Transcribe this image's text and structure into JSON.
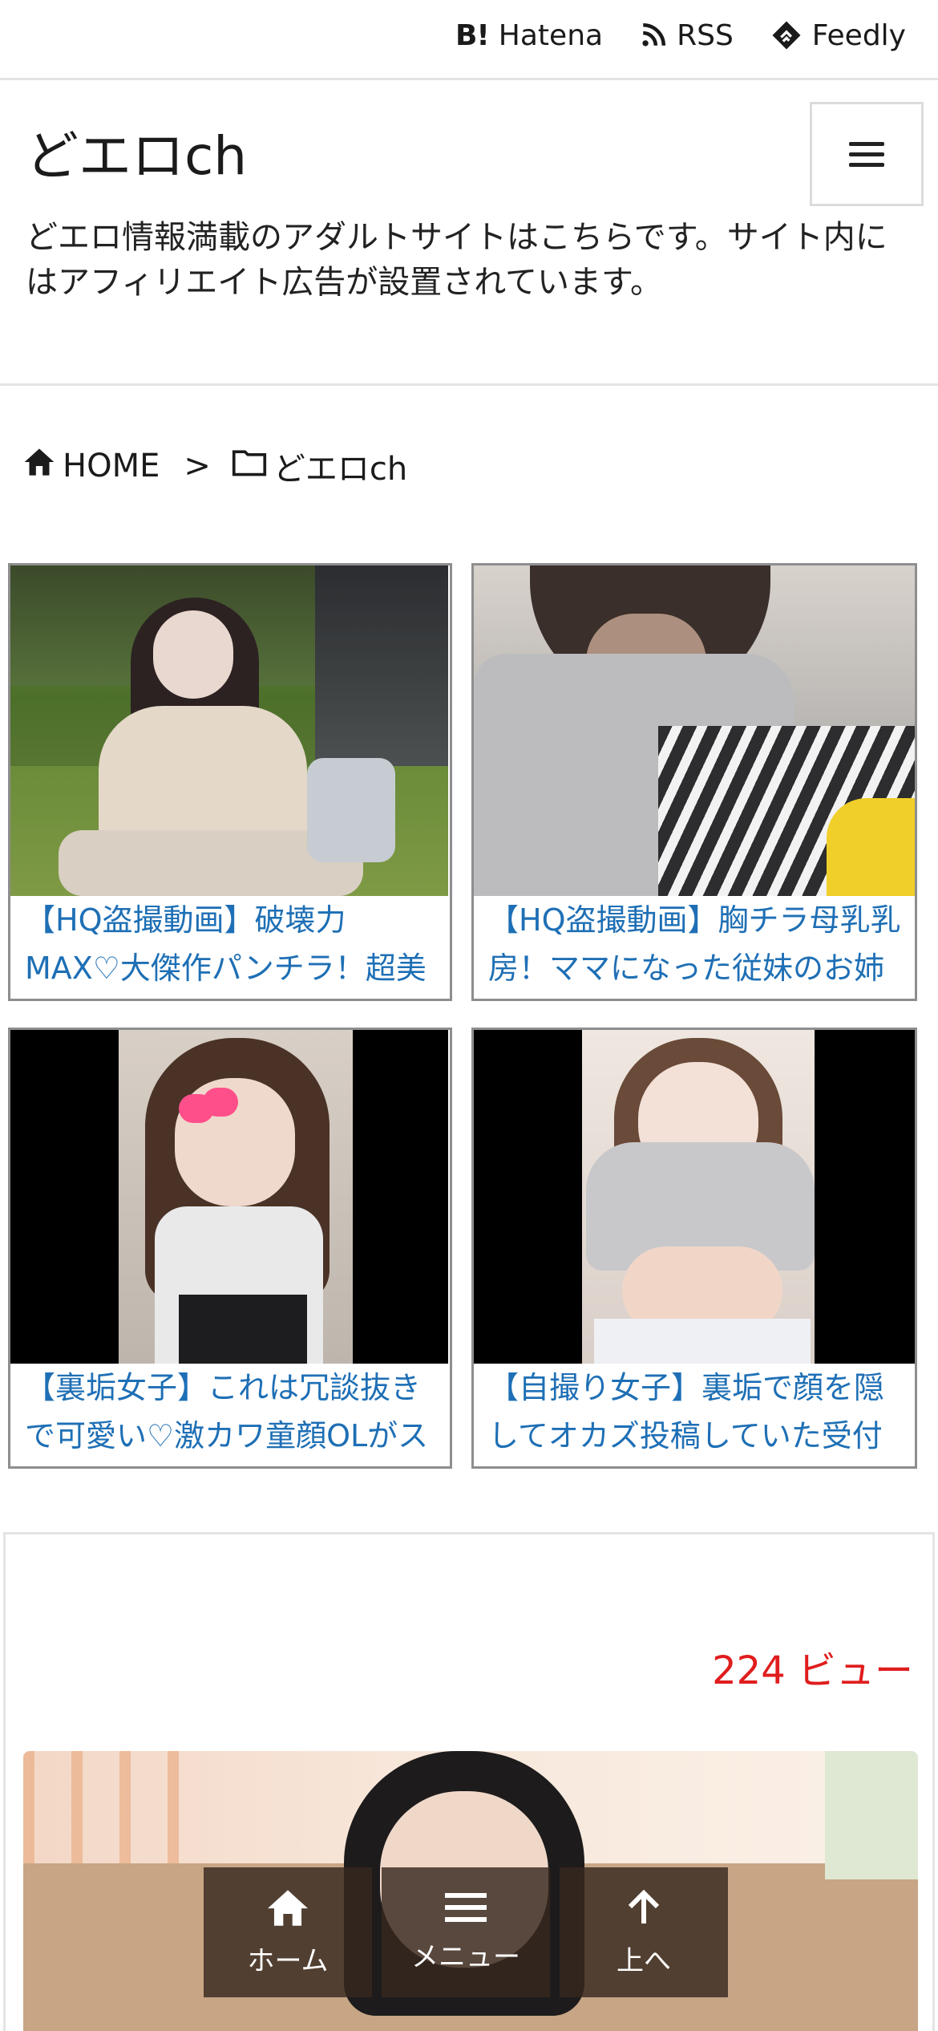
{
  "topbar": {
    "links": [
      {
        "icon": "hatena-bookmark-icon",
        "icon_text": "B!",
        "label": "Hatena"
      },
      {
        "icon": "rss-icon",
        "label": "RSS"
      },
      {
        "icon": "feedly-icon",
        "label": "Feedly"
      }
    ]
  },
  "header": {
    "title": "どエロch",
    "description": "どエロ情報満載のアダルトサイトはこちらです。サイト内にはアフィリエイト広告が設置されています。",
    "menu_icon": "hamburger-menu-icon"
  },
  "breadcrumb": {
    "home_label": "HOME",
    "separator": ">",
    "category_label": "どエロch"
  },
  "cards": [
    {
      "title": "【HQ盗撮動画】破壊力MAX♡大傑作パンチラ！超美形大人お姉様の桃尻パンチラ",
      "thumb": "park-photo"
    },
    {
      "title": "【HQ盗撮動画】胸チラ母乳乳房！ママになった従妹のお姉さんの胸チラを盗撮",
      "thumb": "grey-photo"
    },
    {
      "title": "【裏垢女子】これは冗談抜きで可愛い♡激カワ童顔OLがスカートめくりパンチラ",
      "thumb": "portrait-photo"
    },
    {
      "title": "【自撮り女子】裏垢で顔を隠してオカズ投稿していた受付嬢の娘が結局は美顔まで晒す",
      "thumb": "portrait-photo"
    }
  ],
  "article": {
    "views": "224 ビュー"
  },
  "bottom_nav": [
    {
      "icon": "home-icon",
      "label": "ホーム"
    },
    {
      "icon": "menu-icon",
      "label": "メニュー"
    },
    {
      "icon": "arrow-up-icon",
      "label": "上へ"
    }
  ]
}
